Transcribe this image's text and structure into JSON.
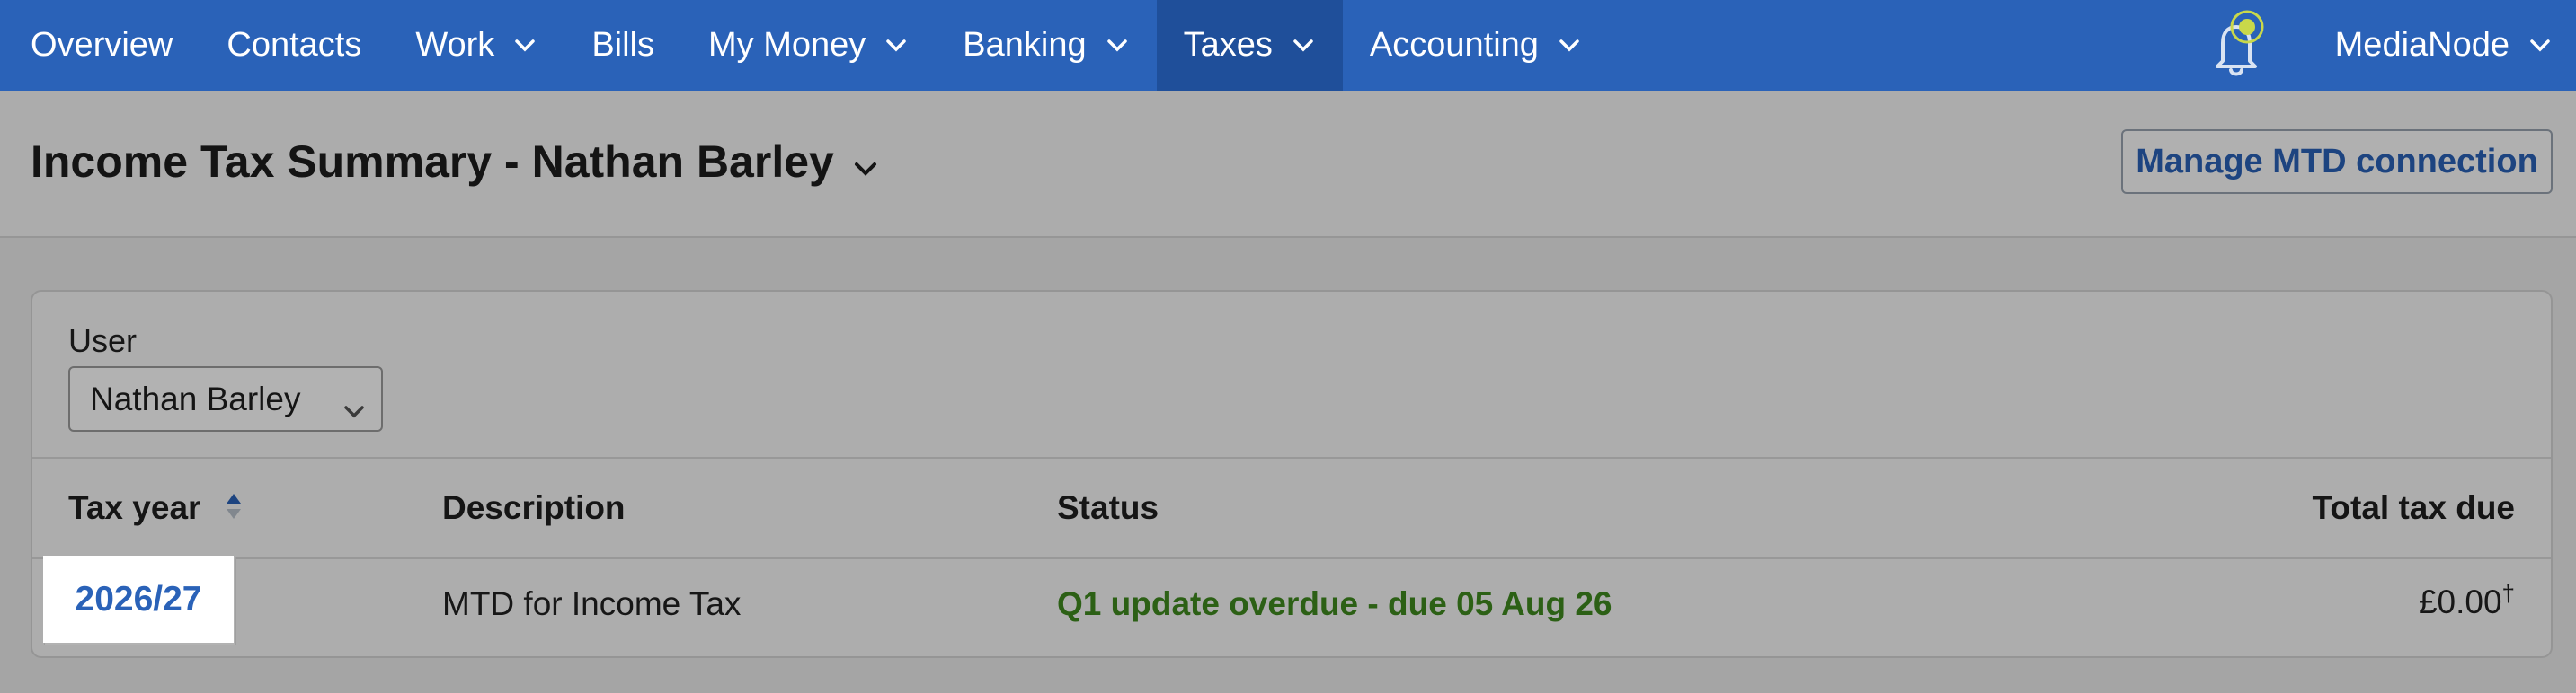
{
  "nav": {
    "items": [
      {
        "label": "Overview",
        "has_menu": false
      },
      {
        "label": "Contacts",
        "has_menu": false
      },
      {
        "label": "Work",
        "has_menu": true
      },
      {
        "label": "Bills",
        "has_menu": false
      },
      {
        "label": "My Money",
        "has_menu": true
      },
      {
        "label": "Banking",
        "has_menu": true
      },
      {
        "label": "Taxes",
        "has_menu": true,
        "active": true
      },
      {
        "label": "Accounting",
        "has_menu": true
      }
    ],
    "org_name": "MediaNode",
    "bell_icon": "bell-icon"
  },
  "header": {
    "title": "Income Tax Summary - Nathan Barley",
    "mtd_button": "Manage MTD connection"
  },
  "filters": {
    "user_label": "User",
    "user_value": "Nathan Barley"
  },
  "table": {
    "columns": [
      "Tax year",
      "Description",
      "Status",
      "Total tax due"
    ],
    "rows": [
      {
        "tax_year": "2026/27",
        "description": "MTD for Income Tax",
        "status": "Q1 update overdue - due 05 Aug 26",
        "total": "£0.00",
        "total_mark": "†"
      }
    ]
  },
  "colors": {
    "nav_bg": "#2a62b8",
    "nav_active": "#1f4f9a",
    "link": "#2a62b8",
    "status_green": "#3f8a1f",
    "notification_dot": "#c9d84a"
  }
}
